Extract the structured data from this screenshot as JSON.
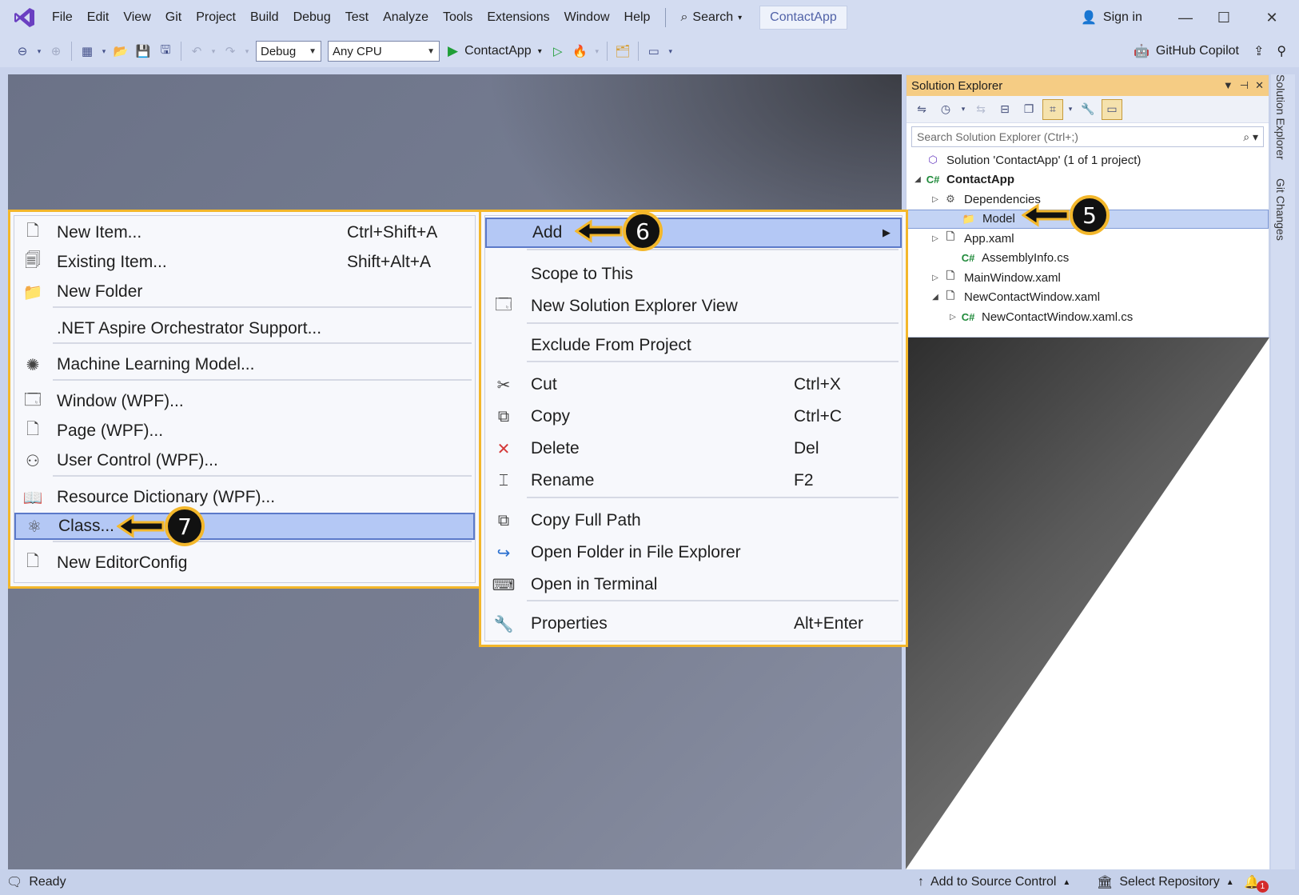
{
  "titlebar": {
    "menus": [
      "File",
      "Edit",
      "View",
      "Git",
      "Project",
      "Build",
      "Debug",
      "Test",
      "Analyze",
      "Tools",
      "Extensions",
      "Window",
      "Help"
    ],
    "search_label": "Search",
    "app_title": "ContactApp",
    "sign_in": "Sign in"
  },
  "toolbar": {
    "config": "Debug",
    "platform": "Any CPU",
    "run_target": "ContactApp",
    "copilot": "GitHub Copilot"
  },
  "solution_explorer": {
    "title": "Solution Explorer",
    "search_placeholder": "Search Solution Explorer (Ctrl+;)",
    "tree": [
      {
        "label": "Solution 'ContactApp' (1 of 1 project)",
        "icon": "solution-icon",
        "expander": ""
      },
      {
        "label": "ContactApp",
        "icon": "csharp-project-icon",
        "expander": "expanded"
      },
      {
        "label": "Dependencies",
        "icon": "dependencies-icon",
        "expander": "collapsed"
      },
      {
        "label": "Model",
        "icon": "folder-icon",
        "expander": "",
        "selected": true
      },
      {
        "label": "App.xaml",
        "icon": "xaml-file-icon",
        "expander": "collapsed"
      },
      {
        "label": "AssemblyInfo.cs",
        "icon": "csharp-file-icon",
        "expander": ""
      },
      {
        "label": "MainWindow.xaml",
        "icon": "xaml-file-icon",
        "expander": "collapsed"
      },
      {
        "label": "NewContactWindow.xaml",
        "icon": "xaml-file-icon",
        "expander": "expanded"
      },
      {
        "label": "NewContactWindow.xaml.cs",
        "icon": "csharp-file-icon",
        "expander": "collapsed"
      }
    ]
  },
  "right_rail": {
    "tabs": [
      "Solution Explorer",
      "Git Changes"
    ]
  },
  "add_submenu": {
    "items": [
      {
        "label": "New Item...",
        "shortcut": "Ctrl+Shift+A",
        "icon": "new-item-icon"
      },
      {
        "label": "Existing Item...",
        "shortcut": "Shift+Alt+A",
        "icon": "existing-item-icon"
      },
      {
        "label": "New Folder",
        "shortcut": "",
        "icon": "new-folder-icon"
      },
      {
        "label": ".NET Aspire Orchestrator Support...",
        "shortcut": "",
        "icon": ""
      },
      {
        "label": "Machine Learning Model...",
        "shortcut": "",
        "icon": "ml-model-icon"
      },
      {
        "label": "Window (WPF)...",
        "shortcut": "",
        "icon": "window-icon"
      },
      {
        "label": "Page (WPF)...",
        "shortcut": "",
        "icon": "page-icon"
      },
      {
        "label": "User Control (WPF)...",
        "shortcut": "",
        "icon": "user-control-icon"
      },
      {
        "label": "Resource Dictionary (WPF)...",
        "shortcut": "",
        "icon": "resource-dictionary-icon"
      },
      {
        "label": "Class...",
        "shortcut": "",
        "icon": "class-icon",
        "highlighted": true
      },
      {
        "label": "New EditorConfig",
        "shortcut": "",
        "icon": "editorconfig-icon"
      }
    ]
  },
  "context_menu": {
    "items": [
      {
        "label": "Add",
        "shortcut": "",
        "icon": "",
        "highlighted": true,
        "submenu": true
      },
      {
        "label": "Scope to This",
        "shortcut": "",
        "icon": ""
      },
      {
        "label": "New Solution Explorer View",
        "shortcut": "",
        "icon": "new-view-icon"
      },
      {
        "label": "Exclude From Project",
        "shortcut": "",
        "icon": ""
      },
      {
        "label": "Cut",
        "shortcut": "Ctrl+X",
        "icon": "cut-icon"
      },
      {
        "label": "Copy",
        "shortcut": "Ctrl+C",
        "icon": "copy-icon"
      },
      {
        "label": "Delete",
        "shortcut": "Del",
        "icon": "delete-icon"
      },
      {
        "label": "Rename",
        "shortcut": "F2",
        "icon": "rename-icon"
      },
      {
        "label": "Copy Full Path",
        "shortcut": "",
        "icon": "copy-path-icon"
      },
      {
        "label": "Open Folder in File Explorer",
        "shortcut": "",
        "icon": "open-folder-icon"
      },
      {
        "label": "Open in Terminal",
        "shortcut": "",
        "icon": "terminal-icon"
      },
      {
        "label": "Properties",
        "shortcut": "Alt+Enter",
        "icon": "wrench-icon"
      }
    ]
  },
  "callouts": {
    "step5": "5",
    "step6": "6",
    "step7": "7"
  },
  "statusbar": {
    "ready": "Ready",
    "add_source": "Add to Source Control",
    "select_repo": "Select Repository",
    "notif_count": "1"
  },
  "colors": {
    "highlight_border": "#f3b72b",
    "selection": "#b4c8f5",
    "chrome": "#d3dcf1"
  }
}
